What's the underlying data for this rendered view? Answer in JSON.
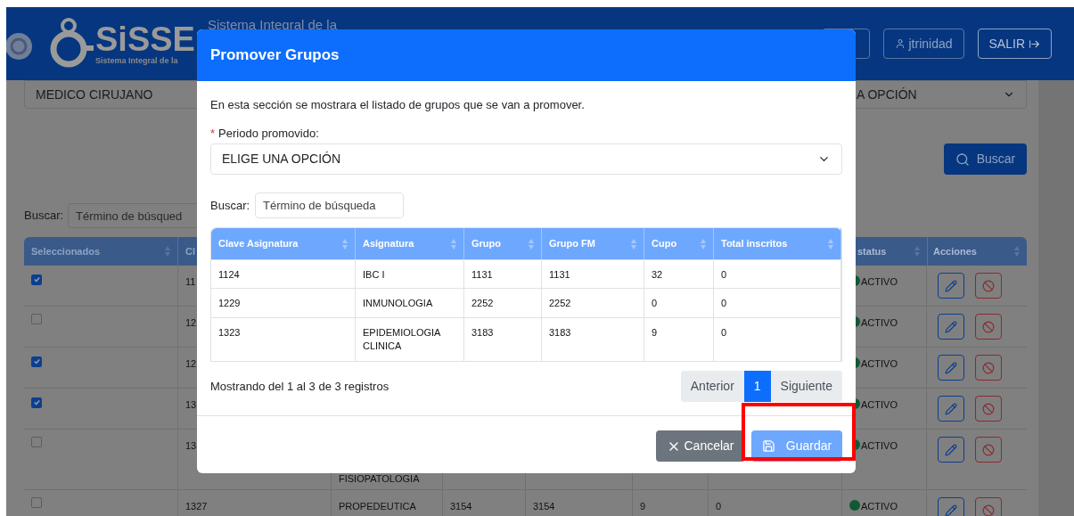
{
  "header": {
    "logo_text": "SiSSE",
    "logo_subtitle": "Sistema Integral de la",
    "system_title": "Sistema Integral de la",
    "user": "jtrinidad",
    "logout": "SALIR"
  },
  "filters": {
    "career": "MEDICO CIRUJANO",
    "period": "A OPCIÓN",
    "search_button": "Buscar"
  },
  "search": {
    "label": "Buscar:",
    "placeholder": "Término de búsqued"
  },
  "table": {
    "columns_left": [
      "Seleccionados",
      "Cl"
    ],
    "columns_right": [
      "status",
      "Acciones"
    ],
    "rows": [
      {
        "selected": true,
        "clave": "11",
        "status": "ACTIVO"
      },
      {
        "selected": false,
        "clave": "12",
        "status": "ACTIVO"
      },
      {
        "selected": true,
        "clave": "12",
        "status": "ACTIVO"
      },
      {
        "selected": true,
        "clave": "13",
        "status": "ACTIVO"
      },
      {
        "selected": false,
        "clave": "13",
        "asignatura": "FISIOPATOLOGIA",
        "status": "ACTIVO"
      },
      {
        "selected": false,
        "clave": "1327",
        "asignatura": "PROPEDEUTICA",
        "grupo": "3154",
        "grupo_fm": "3154",
        "cupo": "9",
        "total": "0",
        "status": "ACTIVO"
      }
    ]
  },
  "modal": {
    "title": "Promover Grupos",
    "description": "En esta sección se mostrara el listado de grupos que se van a promover.",
    "required_mark": "*",
    "period_label": "Periodo promovido:",
    "period_value": "ELIGE UNA OPCIÓN",
    "search_label": "Buscar:",
    "search_placeholder": "Término de búsqueda",
    "columns": [
      "Clave Asignatura",
      "Asignatura",
      "Grupo",
      "Grupo FM",
      "Cupo",
      "Total inscritos"
    ],
    "rows": [
      [
        "1124",
        "IBC I",
        "1131",
        "1131",
        "32",
        "0"
      ],
      [
        "1229",
        "INMUNOLOGIA",
        "2252",
        "2252",
        "0",
        "0"
      ],
      [
        "1323",
        "EPIDEMIOLOGIA CLINICA",
        "3183",
        "3183",
        "9",
        "0"
      ]
    ],
    "info": "Mostrando del 1 al 3 de 3 registros",
    "pagination": [
      {
        "label": "Anterior",
        "selected": false
      },
      {
        "label": "1",
        "selected": true
      },
      {
        "label": "Siguiente",
        "selected": false
      }
    ],
    "cancel": "Cancelar",
    "save": "Guardar"
  },
  "highlight": {
    "kind": "frame",
    "color": "#ff0000"
  }
}
